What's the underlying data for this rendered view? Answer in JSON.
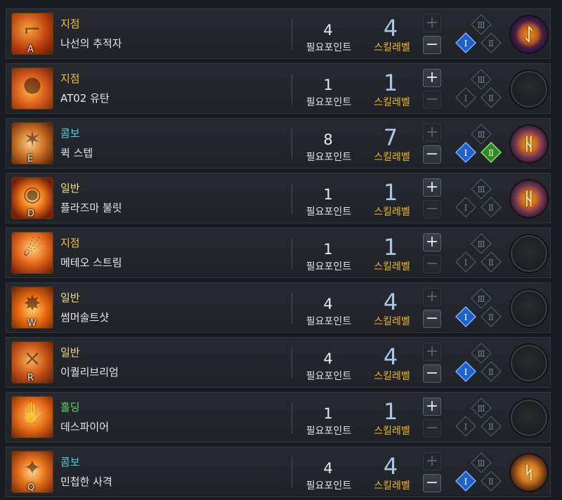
{
  "labels": {
    "required_points": "필요포인트",
    "skill_level": "스킬레벨",
    "plus": "+",
    "minus": "−"
  },
  "colors": {
    "cat_jijeom": "#f2c33a",
    "cat_combo": "#4fd3e6",
    "cat_ilban": "#f0e08a",
    "cat_holding": "#5fdc6a"
  },
  "skills": [
    {
      "hotkey": "A",
      "category": "지점",
      "name": "나선의 추적자",
      "points": "4",
      "level": "4",
      "plus_enabled": false,
      "minus_enabled": true,
      "tripod": {
        "I": true,
        "II": false,
        "III": false
      },
      "rune": "purple",
      "icon": "revolver-icon"
    },
    {
      "hotkey": "",
      "category": "지점",
      "name": "AT02 유탄",
      "points": "1",
      "level": "1",
      "plus_enabled": true,
      "minus_enabled": false,
      "tripod": {
        "I": false,
        "II": false,
        "III": false
      },
      "rune": "none",
      "icon": "grenade-icon"
    },
    {
      "hotkey": "E",
      "category": "콤보",
      "name": "퀵 스텝",
      "points": "8",
      "level": "7",
      "plus_enabled": false,
      "minus_enabled": true,
      "tripod": {
        "I": true,
        "II": true,
        "III": false
      },
      "rune": "pink",
      "icon": "dash-icon"
    },
    {
      "hotkey": "D",
      "category": "일반",
      "name": "플라즈마 불릿",
      "points": "1",
      "level": "1",
      "plus_enabled": true,
      "minus_enabled": false,
      "tripod": {
        "I": false,
        "II": false,
        "III": false
      },
      "rune": "pink",
      "icon": "plasma-icon"
    },
    {
      "hotkey": "",
      "category": "지점",
      "name": "메테오 스트림",
      "points": "1",
      "level": "1",
      "plus_enabled": true,
      "minus_enabled": false,
      "tripod": {
        "I": false,
        "II": false,
        "III": false
      },
      "rune": "none",
      "icon": "meteor-icon"
    },
    {
      "hotkey": "W",
      "category": "일반",
      "name": "썸머솔트샷",
      "points": "4",
      "level": "4",
      "plus_enabled": false,
      "minus_enabled": true,
      "tripod": {
        "I": true,
        "II": false,
        "III": false
      },
      "rune": "none",
      "icon": "somersault-icon"
    },
    {
      "hotkey": "R",
      "category": "일반",
      "name": "이퀄리브리엄",
      "points": "4",
      "level": "4",
      "plus_enabled": false,
      "minus_enabled": true,
      "tripod": {
        "I": true,
        "II": false,
        "III": false
      },
      "rune": "none",
      "icon": "dual-pistol-icon"
    },
    {
      "hotkey": "",
      "category": "홀딩",
      "name": "데스파이어",
      "points": "1",
      "level": "1",
      "plus_enabled": true,
      "minus_enabled": false,
      "tripod": {
        "I": false,
        "II": false,
        "III": false
      },
      "rune": "none",
      "icon": "hand-fire-icon"
    },
    {
      "hotkey": "Q",
      "category": "콤보",
      "name": "민첩한 사격",
      "points": "4",
      "level": "4",
      "plus_enabled": false,
      "minus_enabled": true,
      "tripod": {
        "I": true,
        "II": false,
        "III": false
      },
      "rune": "orange",
      "icon": "rapid-fire-icon"
    }
  ]
}
